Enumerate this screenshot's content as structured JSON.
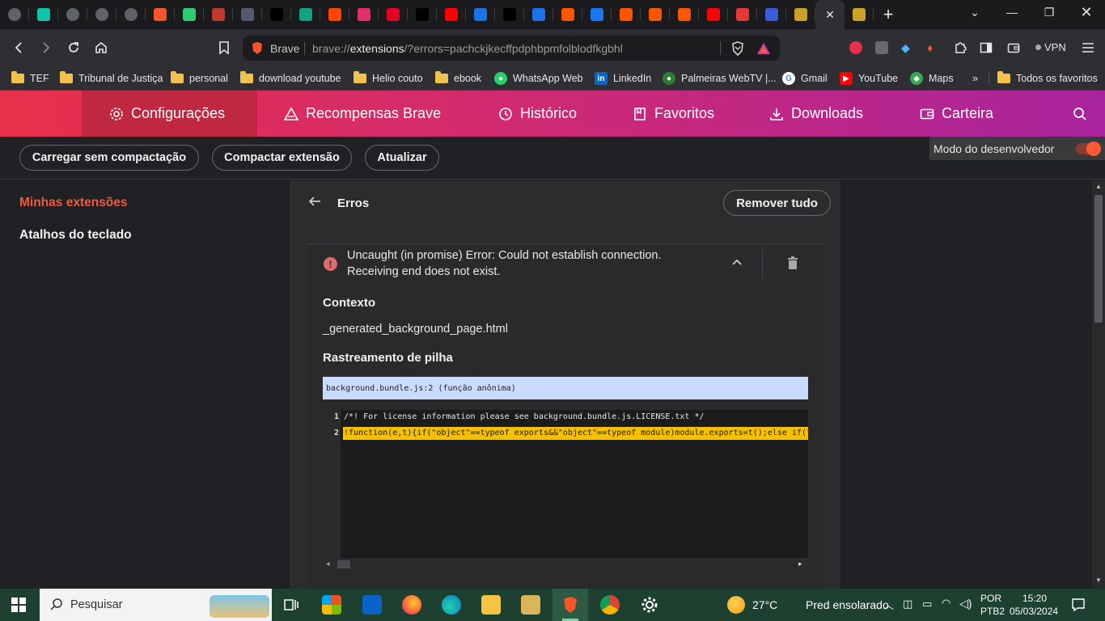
{
  "browser": {
    "brand": "Brave",
    "url_scheme": "brave://",
    "url_host": "extensions",
    "url_rest": "/?errors=pachckjkecffpdphbpmfolblodfkgbhl",
    "vpn_label": "VPN"
  },
  "tabs": [
    {
      "icon": "globe-icon",
      "color": "#5f6368"
    },
    {
      "icon": "gb-icon",
      "color": "#11c4a8"
    },
    {
      "icon": "globe-icon",
      "color": "#5f6368"
    },
    {
      "icon": "globe-icon",
      "color": "#5f6368"
    },
    {
      "icon": "globe-icon",
      "color": "#5f6368"
    },
    {
      "icon": "brave-icon",
      "color": "#fb542b"
    },
    {
      "icon": "bulb-icon",
      "color": "#2ecc71"
    },
    {
      "icon": "bars-icon",
      "color": "#c0392b"
    },
    {
      "icon": "link-icon",
      "color": "#555b6e"
    },
    {
      "icon": "x-icon",
      "color": "#000000"
    },
    {
      "icon": "chatgpt-icon",
      "color": "#10a37f"
    },
    {
      "icon": "reddit-icon",
      "color": "#ff4500"
    },
    {
      "icon": "instagram-icon",
      "color": "#e1306c"
    },
    {
      "icon": "pinterest-icon",
      "color": "#e60023"
    },
    {
      "icon": "x-icon",
      "color": "#000000"
    },
    {
      "icon": "youtube-icon",
      "color": "#ff0000"
    },
    {
      "icon": "play-icon",
      "color": "#1a73e8"
    },
    {
      "icon": "x-icon",
      "color": "#000000"
    },
    {
      "icon": "play-icon",
      "color": "#1a73e8"
    },
    {
      "icon": "orange-square-icon",
      "color": "#ff5500"
    },
    {
      "icon": "facebook-icon",
      "color": "#1877f2"
    },
    {
      "icon": "orange-square-icon",
      "color": "#ff5500"
    },
    {
      "icon": "orange-square-icon",
      "color": "#ff5500"
    },
    {
      "icon": "orange-square-icon",
      "color": "#ff5500"
    },
    {
      "icon": "youtube-icon",
      "color": "#ff0000"
    },
    {
      "icon": "record-icon",
      "color": "#e53935"
    },
    {
      "icon": "m-icon",
      "color": "#3b5bdb"
    },
    {
      "icon": "bw-icon",
      "color": "#c9a227"
    },
    {
      "icon": "bw-icon",
      "color": "#c9a227"
    }
  ],
  "bookmarks": [
    {
      "label": "TEF",
      "type": "folder"
    },
    {
      "label": "Tribunal de Justiça",
      "type": "folder"
    },
    {
      "label": "personal",
      "type": "folder"
    },
    {
      "label": "download youtube",
      "type": "folder"
    },
    {
      "label": "Helio couto",
      "type": "folder"
    },
    {
      "label": "ebook",
      "type": "folder"
    },
    {
      "label": "WhatsApp Web",
      "type": "whatsapp"
    },
    {
      "label": "LinkedIn",
      "type": "linkedin"
    },
    {
      "label": "Palmeiras WebTV |...",
      "type": "palmeiras"
    },
    {
      "label": "Gmail",
      "type": "google"
    },
    {
      "label": "YouTube",
      "type": "youtube"
    },
    {
      "label": "Maps",
      "type": "maps"
    }
  ],
  "bookmarks_more": "»",
  "bookmarks_all": "Todos os favoritos",
  "nav": {
    "settings": "Configurações",
    "rewards": "Recompensas Brave",
    "history": "Histórico",
    "bookmarks": "Favoritos",
    "downloads": "Downloads",
    "wallet": "Carteira"
  },
  "actions": {
    "load_unpacked": "Carregar sem compactação",
    "pack": "Compactar extensão",
    "update": "Atualizar",
    "dev_mode": "Modo do desenvolvedor",
    "dev_mode_on": true
  },
  "sidebar": {
    "my_extensions": "Minhas extensões",
    "shortcuts": "Atalhos do teclado"
  },
  "errors": {
    "title": "Erros",
    "remove_all": "Remover tudo",
    "message_line1": "Uncaught (in promise) Error: Could not establish connection.",
    "message_line2": "Receiving end does not exist.",
    "context_label": "Contexto",
    "context_value": "_generated_background_page.html",
    "stack_label": "Rastreamento de pilha",
    "stack_frame": "background.bundle.js:2 (função anônima)",
    "code": [
      {
        "n": "1",
        "text": "/*! For license information please see background.bundle.js.LICENSE.txt */"
      },
      {
        "n": "2",
        "text": "!function(e,t){if(\"object\"==typeof exports&&\"object\"==typeof module)module.exports=t();else if(\"function\"==typeof define&&define.amd)define([],t);"
      }
    ]
  },
  "taskbar": {
    "search_placeholder": "Pesquisar",
    "weather_temp": "27°C",
    "weather_desc": "Pred ensolarado",
    "lang1": "POR",
    "lang2": "PTB2",
    "time": "15:20",
    "date": "05/03/2024"
  }
}
